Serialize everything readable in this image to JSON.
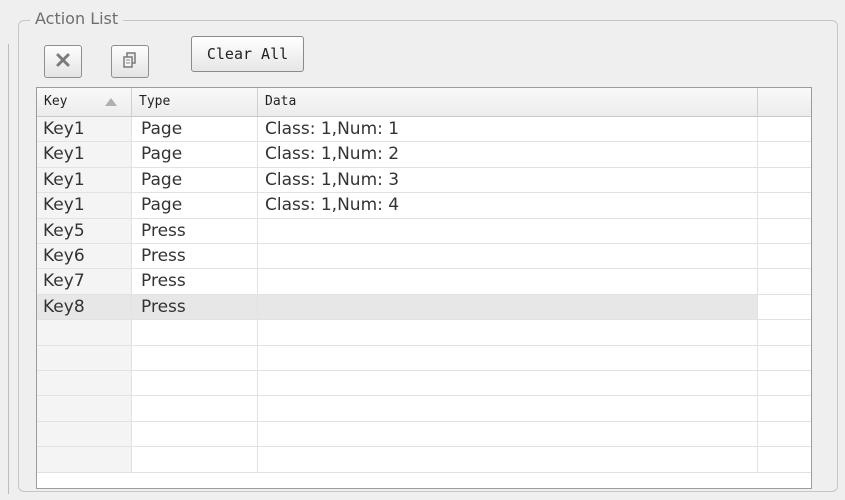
{
  "group": {
    "title": "Action List"
  },
  "toolbar": {
    "delete_icon": "delete-x-icon",
    "copy_icon": "copy-icon",
    "clear_label": "Clear All"
  },
  "table": {
    "headers": [
      "Key",
      "Type",
      "Data",
      ""
    ],
    "sort_column": "Key",
    "sort_direction": "ascending",
    "rows": [
      {
        "key": "Key1",
        "type": "Page",
        "data": "Class: 1,Num: 1"
      },
      {
        "key": "Key1",
        "type": "Page",
        "data": "Class: 1,Num: 2"
      },
      {
        "key": "Key1",
        "type": "Page",
        "data": "Class: 1,Num: 3"
      },
      {
        "key": "Key1",
        "type": "Page",
        "data": "Class: 1,Num: 4"
      },
      {
        "key": "Key5",
        "type": "Press",
        "data": ""
      },
      {
        "key": "Key6",
        "type": "Press",
        "data": ""
      },
      {
        "key": "Key7",
        "type": "Press",
        "data": ""
      },
      {
        "key": "Key8",
        "type": "Press",
        "data": ""
      },
      {
        "key": "",
        "type": "",
        "data": ""
      },
      {
        "key": "",
        "type": "",
        "data": ""
      },
      {
        "key": "",
        "type": "",
        "data": ""
      },
      {
        "key": "",
        "type": "",
        "data": ""
      },
      {
        "key": "",
        "type": "",
        "data": ""
      },
      {
        "key": "",
        "type": "",
        "data": ""
      }
    ],
    "selected_row": 7
  }
}
